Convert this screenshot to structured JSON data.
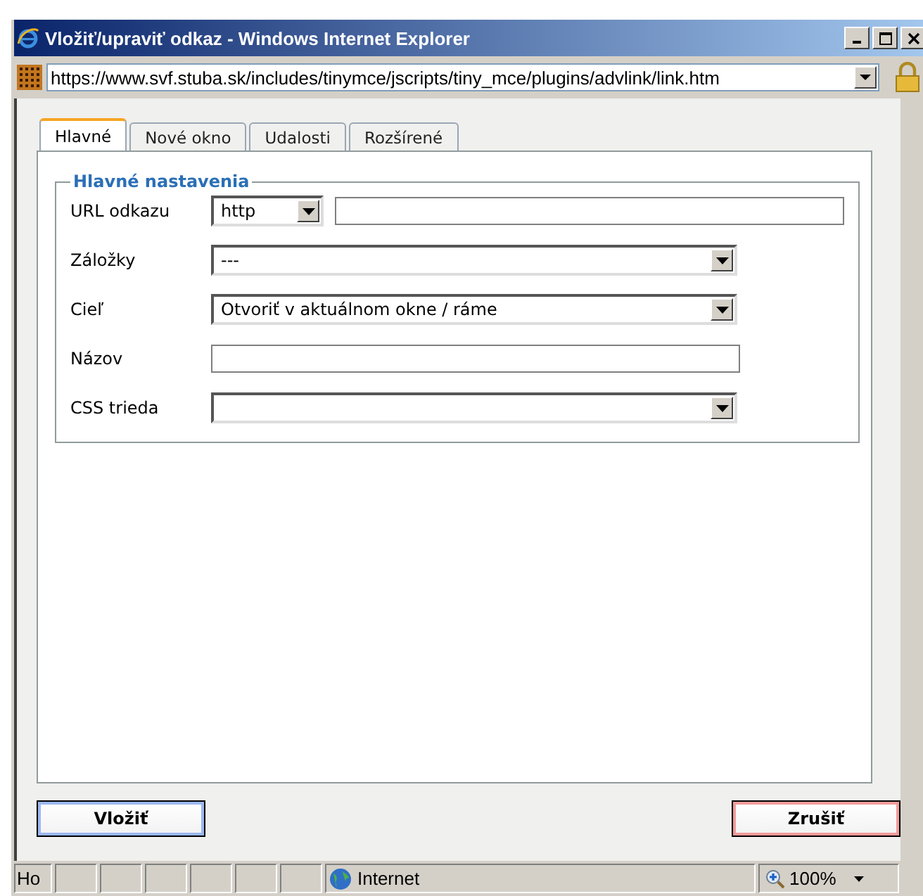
{
  "window": {
    "title": "Vložiť/upraviť odkaz - Windows Internet Explorer"
  },
  "address": {
    "url": "https://www.svf.stuba.sk/includes/tinymce/jscripts/tiny_mce/plugins/advlink/link.htm"
  },
  "tabs": [
    {
      "label": "Hlavné",
      "selected": true
    },
    {
      "label": "Nové okno",
      "selected": false
    },
    {
      "label": "Udalosti",
      "selected": false
    },
    {
      "label": "Rozšírené",
      "selected": false
    }
  ],
  "fieldset": {
    "legend": "Hlavné nastavenia",
    "fields": [
      {
        "label": "URL odkazu",
        "kind": "url",
        "protocol": "http"
      },
      {
        "label": "Záložky",
        "kind": "select",
        "value": "---"
      },
      {
        "label": "Cieľ",
        "kind": "select",
        "value": "Otvoriť v aktuálnom okne / ráme"
      },
      {
        "label": "Názov",
        "kind": "input"
      },
      {
        "label": "CSS trieda",
        "kind": "select"
      }
    ]
  },
  "buttons": [
    {
      "label": "Vložiť",
      "kind": "primary"
    },
    {
      "label": "Zrušiť",
      "kind": "cancel"
    }
  ],
  "status_bar": {
    "text": "Ho",
    "zone": "Internet",
    "zoom": "100%"
  }
}
